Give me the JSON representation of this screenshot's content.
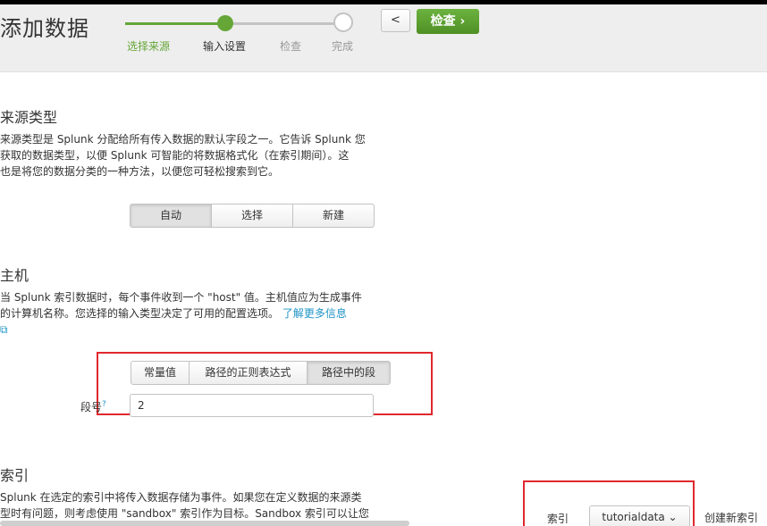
{
  "header": {
    "title": "添加数据",
    "steps": [
      "选择来源",
      "输入设置",
      "检查",
      "完成"
    ],
    "back_label": "<",
    "next_label": "检查 ›"
  },
  "source_type": {
    "title": "来源类型",
    "desc_lines": [
      "来源类型是 Splunk 分配给所有传入数据的默认字段之一。它告诉 Splunk 您",
      "获取的数据类型，以便 Splunk 可智能的将数据格式化（在索引期间）。这",
      "也是将您的数据分类的一种方法，以便您可轻松搜索到它。"
    ],
    "buttons": [
      "自动",
      "选择",
      "新建"
    ]
  },
  "host": {
    "title": "主机",
    "desc_lines": [
      "当 Splunk 索引数据时，每个事件收到一个 \"host\" 值。主机值应为生成事件",
      "的计算机名称。您选择的输入类型决定了可用的配置选项。"
    ],
    "learn_more": "了解更多信息",
    "external_icon": "⧉",
    "options": [
      "常量值",
      "路径的正则表达式",
      "路径中的段"
    ],
    "segment_label": "段号",
    "help_mark": "?",
    "segment_value": "2"
  },
  "index": {
    "title": "索引",
    "desc_lines": [
      "Splunk 在选定的索引中将传入数据存储为事件。如果您在定义数据的来源类",
      "型时有问题，则考虑使用 \"sandbox\" 索引作为目标。Sandbox 索引可以让您"
    ],
    "field_label": "索引",
    "selected": "tutorialdata ⌄",
    "create_link": "创建新索引"
  }
}
